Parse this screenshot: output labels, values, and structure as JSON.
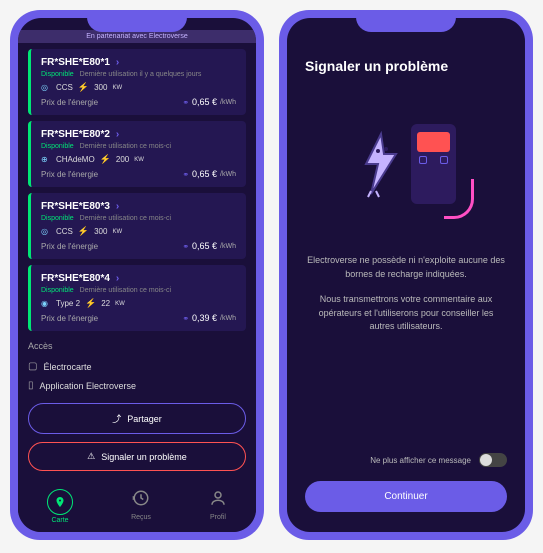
{
  "banner": "En partenariat avec Electroverse",
  "chargers": [
    {
      "id": "FR*SHE*E80*1",
      "status": "Disponible",
      "usage": "Dernière utilisation il y a quelques jours",
      "connector": "CCS",
      "power": "300",
      "power_unit": "KW",
      "price_label": "Prix de l'énergie",
      "price": "0,65 €",
      "price_unit": "/kWh"
    },
    {
      "id": "FR*SHE*E80*2",
      "status": "Disponible",
      "usage": "Dernière utilisation ce mois-ci",
      "connector": "CHAdeMO",
      "power": "200",
      "power_unit": "KW",
      "price_label": "Prix de l'énergie",
      "price": "0,65 €",
      "price_unit": "/kWh"
    },
    {
      "id": "FR*SHE*E80*3",
      "status": "Disponible",
      "usage": "Dernière utilisation ce mois-ci",
      "connector": "CCS",
      "power": "300",
      "power_unit": "KW",
      "price_label": "Prix de l'énergie",
      "price": "0,65 €",
      "price_unit": "/kWh"
    },
    {
      "id": "FR*SHE*E80*4",
      "status": "Disponible",
      "usage": "Dernière utilisation ce mois-ci",
      "connector": "Type 2",
      "power": "22",
      "power_unit": "KW",
      "price_label": "Prix de l'énergie",
      "price": "0,39 €",
      "price_unit": "/kWh"
    }
  ],
  "access": {
    "title": "Accès",
    "items": [
      {
        "icon": "card",
        "label": "Électrocarte"
      },
      {
        "icon": "phone",
        "label": "Application Electroverse"
      }
    ]
  },
  "buttons": {
    "share": "Partager",
    "report": "Signaler un problème"
  },
  "nav": {
    "map": "Carte",
    "receipts": "Reçus",
    "profile": "Profil"
  },
  "modal": {
    "title": "Signaler un problème",
    "text1": "Electroverse ne possède ni n'exploite aucune des bornes de recharge indiquées.",
    "text2": "Nous transmettrons votre commentaire aux opérateurs et l'utiliserons pour conseiller les autres utilisateurs.",
    "toggle_label": "Ne plus afficher ce message",
    "continue": "Continuer"
  }
}
